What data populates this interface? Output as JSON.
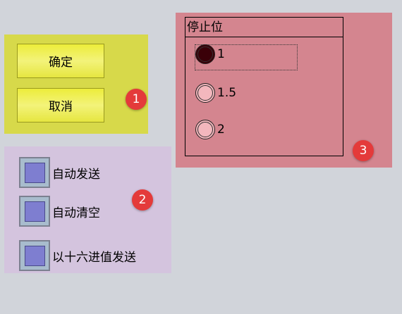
{
  "buttons": {
    "ok_label": "确定",
    "cancel_label": "取消"
  },
  "badges": [
    "1",
    "2",
    "3"
  ],
  "checkboxes": [
    {
      "label": "自动发送",
      "checked": false
    },
    {
      "label": "自动清空",
      "checked": false
    },
    {
      "label": "以十六进值发送",
      "checked": false
    }
  ],
  "stop_bits": {
    "title": "停止位",
    "options": [
      {
        "label": "1",
        "selected": true
      },
      {
        "label": "1.5",
        "selected": false
      },
      {
        "label": "2",
        "selected": false
      }
    ]
  },
  "colors": {
    "panel_1": "#d7d94a",
    "panel_2": "#d4c4de",
    "panel_3": "#d4858f",
    "badge": "#e43a3a",
    "background": "#d1d4da"
  }
}
